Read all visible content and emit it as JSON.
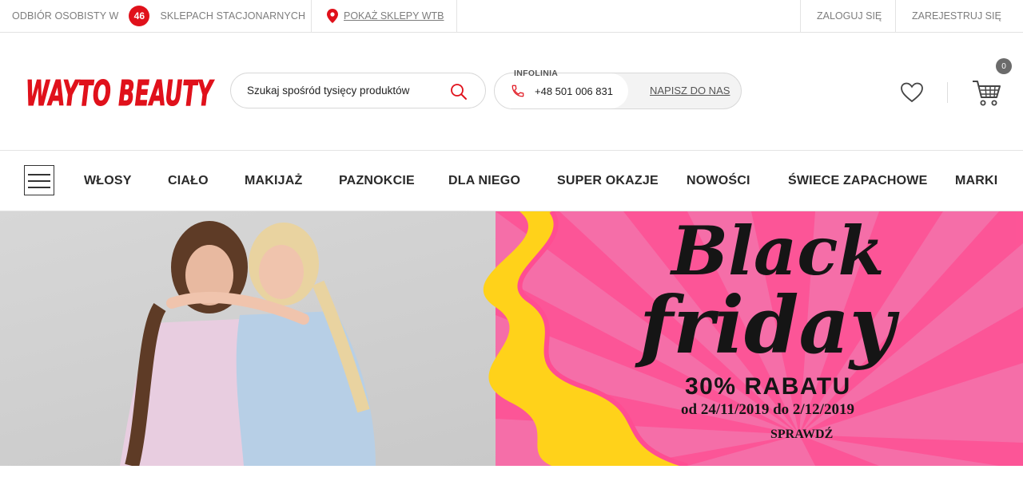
{
  "topbar": {
    "pickup_prefix": "ODBIÓR OSOBISTY W",
    "store_count": "46",
    "pickup_suffix": "SKLEPACH STACJONARNYCH",
    "show_stores": "POKAŻ SKLEPY WTB",
    "login": "ZALOGUJ SIĘ",
    "register": "ZAREJESTRUJ SIĘ"
  },
  "header": {
    "logo_text": "WAYTO BEAUTY",
    "search_placeholder": "Szukaj spośród tysięcy produktów",
    "hotline_label": "INFOLINIA",
    "phone": "+48 501 006 831",
    "write_us": "NAPISZ DO NAS",
    "cart_count": "0"
  },
  "nav": {
    "items": [
      "WŁOSY",
      "CIAŁO",
      "MAKIJAŻ",
      "PAZNOKCIE",
      "DLA NIEGO",
      "SUPER OKAZJE",
      "NOWOŚCI",
      "ŚWIECE ZAPACHOWE",
      "MARKI"
    ]
  },
  "hero": {
    "headline_1": "Black",
    "headline_2": "friday",
    "discount": "30% RABATU",
    "dates": "od 24/11/2019 do 2/12/2019",
    "cta": "SPRAWDŹ"
  },
  "colors": {
    "brand_red": "#e0111b",
    "banner_pink": "#f56ea8",
    "banner_yellow": "#ffd21a"
  },
  "icons": [
    "location-pin-icon",
    "search-icon",
    "phone-icon",
    "heart-icon",
    "cart-icon",
    "hamburger-menu-icon"
  ]
}
